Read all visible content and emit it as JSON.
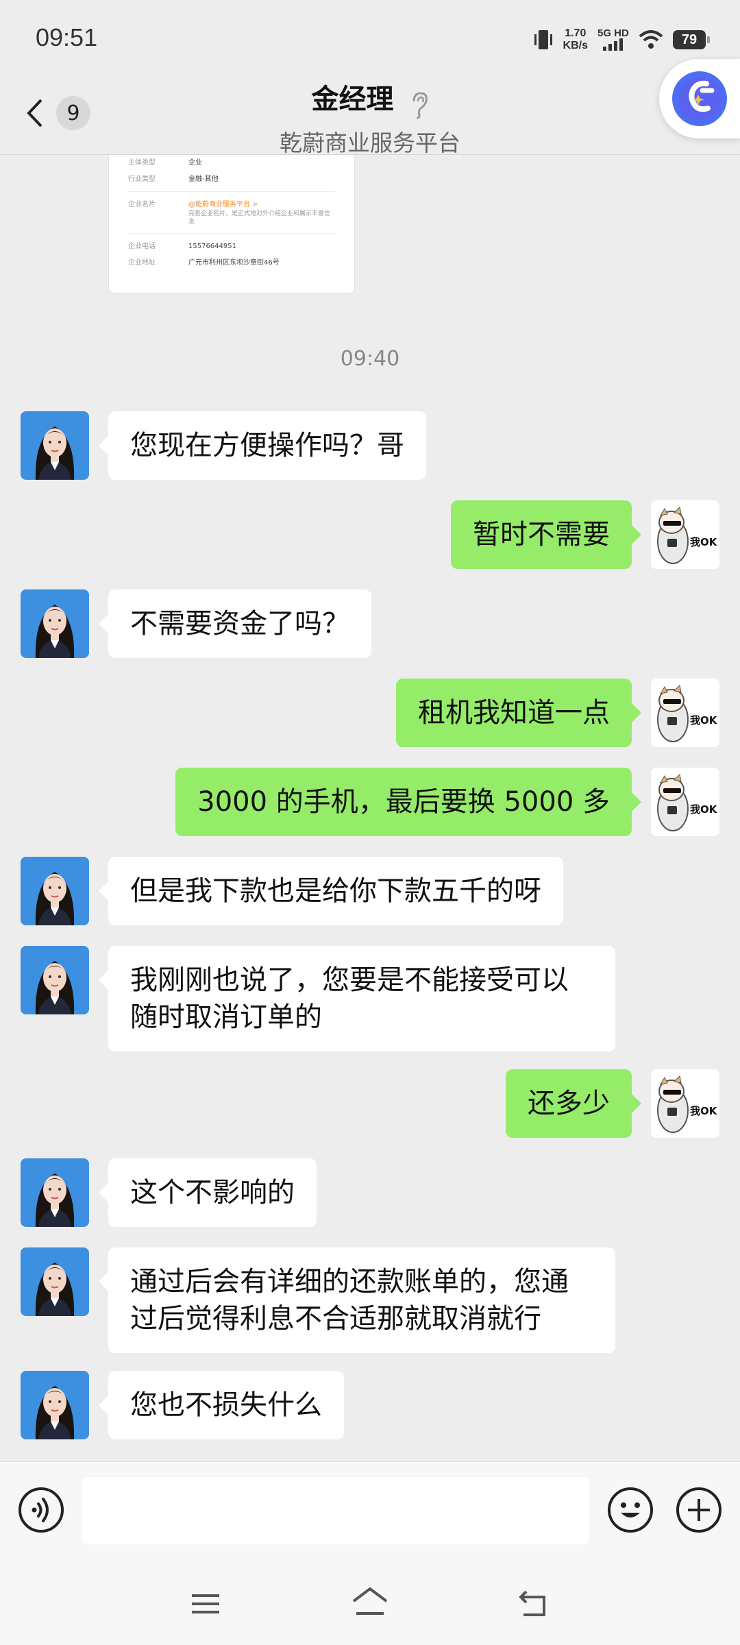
{
  "status_bar": {
    "time": "09:51",
    "net_speed_value": "1.70",
    "net_speed_unit": "KB/s",
    "network_label": "5G HD",
    "battery": "79"
  },
  "header": {
    "unread_count": "9",
    "title": "金经理",
    "subtitle": "乾蔚商业服务平台"
  },
  "card_preview": {
    "rows": [
      {
        "key": "主体类型",
        "value": "企业"
      },
      {
        "key": "行业类型",
        "value": "金融-其他"
      },
      {
        "key": "企业名片",
        "value": "@乾蔚商业服务平台 >",
        "desc": "完善企业名片，是正式地对外介绍企业和展示丰富信息"
      },
      {
        "key": "企业电话",
        "value": "15576644951"
      },
      {
        "key": "企业地址",
        "value": "广元市利州区东坝沙章街46号"
      }
    ]
  },
  "timestamp": "09:40",
  "messages": [
    {
      "side": "left",
      "text": "您现在方便操作吗？哥"
    },
    {
      "side": "right",
      "text": "暂时不需要"
    },
    {
      "side": "left",
      "text": "不需要资金了吗？"
    },
    {
      "side": "right",
      "text": "租机我知道一点"
    },
    {
      "side": "right",
      "text": "3000 的手机，最后要换 5000 多"
    },
    {
      "side": "left",
      "text": "但是我下款也是给你下款五千的呀"
    },
    {
      "side": "left",
      "text": "我刚刚也说了，您要是不能接受可以随时取消订单的"
    },
    {
      "side": "right",
      "text": "还多少"
    },
    {
      "side": "left",
      "text": "这个不影响的"
    },
    {
      "side": "left",
      "text": "通过后会有详细的还款账单的，您通过后觉得利息不合适那就取消就行"
    },
    {
      "side": "left",
      "text": "您也不损失什么"
    }
  ],
  "sticker_text": "我OK",
  "input": {
    "value": "",
    "placeholder": ""
  },
  "colors": {
    "sent_bubble": "#95ec69",
    "received_bubble": "#ffffff",
    "background": "#ededed"
  },
  "icons": {
    "back": "chevron-left-icon",
    "earpiece": "ear-icon",
    "floating_app": "app-shortcut-icon",
    "voice": "voice-icon",
    "emoji": "emoji-icon",
    "plus": "plus-icon",
    "nav_menu": "menu-icon",
    "nav_home": "home-icon",
    "nav_back": "back-icon"
  }
}
